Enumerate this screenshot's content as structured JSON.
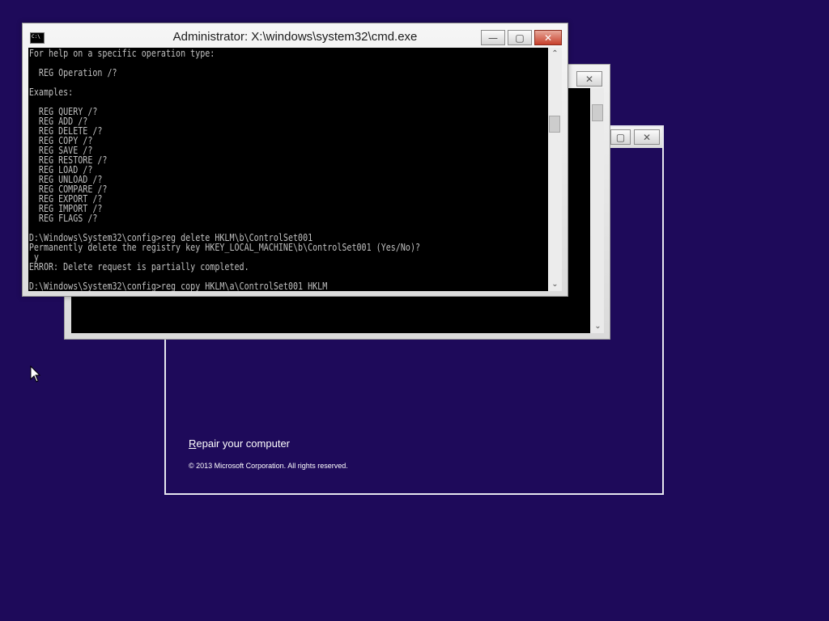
{
  "setup": {
    "repair_first": "R",
    "repair_rest": "epair your computer",
    "copyright": "© 2013 Microsoft Corporation. All rights reserved."
  },
  "cmd": {
    "title": "Administrator: X:\\windows\\system32\\cmd.exe",
    "icon_glyph": "C:\\",
    "output": "For help on a specific operation type:\n\n  REG Operation /?\n\nExamples:\n\n  REG QUERY /?\n  REG ADD /?\n  REG DELETE /?\n  REG COPY /?\n  REG SAVE /?\n  REG RESTORE /?\n  REG LOAD /?\n  REG UNLOAD /?\n  REG COMPARE /?\n  REG EXPORT /?\n  REG IMPORT /?\n  REG FLAGS /?\n\nD:\\Windows\\System32\\config>reg delete HKLM\\b\\ControlSet001\nPermanently delete the registry key HKEY_LOCAL_MACHINE\\b\\ControlSet001 (Yes/No)?\n y\nERROR: Delete request is partially completed.\n\nD:\\Windows\\System32\\config>reg copy HKLM\\a\\ControlSet001 HKLM",
    "buttons": {
      "minimize": "—",
      "maximize": "▢",
      "close": "✕"
    }
  },
  "scroll": {
    "up": "⌃",
    "down": "⌄"
  },
  "icons": {
    "minimize": "minimize-icon",
    "maximize": "maximize-icon",
    "close": "close-icon",
    "pointer": "mouse-pointer-icon"
  },
  "colors": {
    "desktop": "#1e0a5a",
    "console_bg": "#000000",
    "console_text": "#c0c0c0",
    "close_button": "#c7402c"
  }
}
